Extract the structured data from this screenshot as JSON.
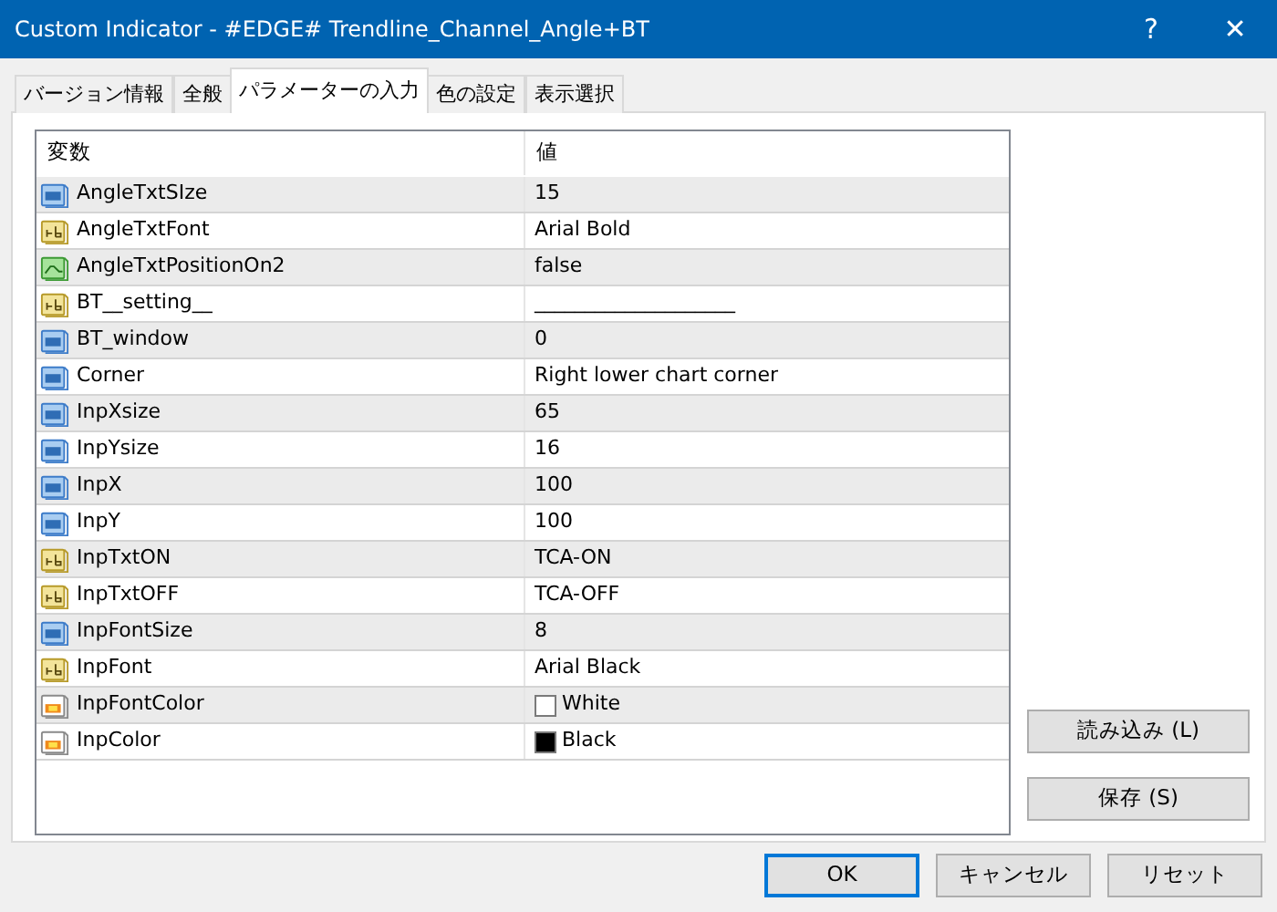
{
  "window": {
    "title": "Custom Indicator - #EDGE# Trendline_Channel_Angle+BT",
    "buttons": [
      "?",
      "✕"
    ]
  },
  "tabs": [
    {
      "label": "バージョン情報",
      "selected": false
    },
    {
      "label": "全般",
      "selected": false
    },
    {
      "label": "パラメーターの入力",
      "selected": true
    },
    {
      "label": "色の設定",
      "selected": false
    },
    {
      "label": "表示選択",
      "selected": false
    }
  ],
  "table": {
    "columns": [
      "変数",
      "値"
    ],
    "rows": [
      {
        "kind": "int",
        "name": "AngleTxtSIze",
        "value": "15"
      },
      {
        "kind": "string",
        "name": "AngleTxtFont",
        "value": "Arial Bold"
      },
      {
        "kind": "bool",
        "name": "AngleTxtPositionOn2",
        "value": "false"
      },
      {
        "kind": "string",
        "name": "BT__setting__",
        "value": "____________________"
      },
      {
        "kind": "int",
        "name": "BT_window",
        "value": "0"
      },
      {
        "kind": "int",
        "name": "Corner",
        "value": "Right lower chart corner"
      },
      {
        "kind": "int",
        "name": "InpXsize",
        "value": "65"
      },
      {
        "kind": "int",
        "name": "InpYsize",
        "value": "16"
      },
      {
        "kind": "int",
        "name": "InpX",
        "value": "100"
      },
      {
        "kind": "int",
        "name": "InpY",
        "value": "100"
      },
      {
        "kind": "string",
        "name": "InpTxtON",
        "value": "TCA-ON"
      },
      {
        "kind": "string",
        "name": "InpTxtOFF",
        "value": "TCA-OFF"
      },
      {
        "kind": "int",
        "name": "InpFontSize",
        "value": "8"
      },
      {
        "kind": "string",
        "name": "InpFont",
        "value": "Arial Black"
      },
      {
        "kind": "color",
        "name": "InpFontColor",
        "value": "White",
        "color": "#ffffff"
      },
      {
        "kind": "color",
        "name": "InpColor",
        "value": "Black",
        "color": "#000000"
      }
    ]
  },
  "side_buttons": [
    "読み込み (L)",
    "保存 (S)"
  ],
  "footer_buttons": [
    {
      "label": "OK",
      "default": true
    },
    {
      "label": "キャンセル",
      "default": false
    },
    {
      "label": "リセット",
      "default": false
    }
  ]
}
